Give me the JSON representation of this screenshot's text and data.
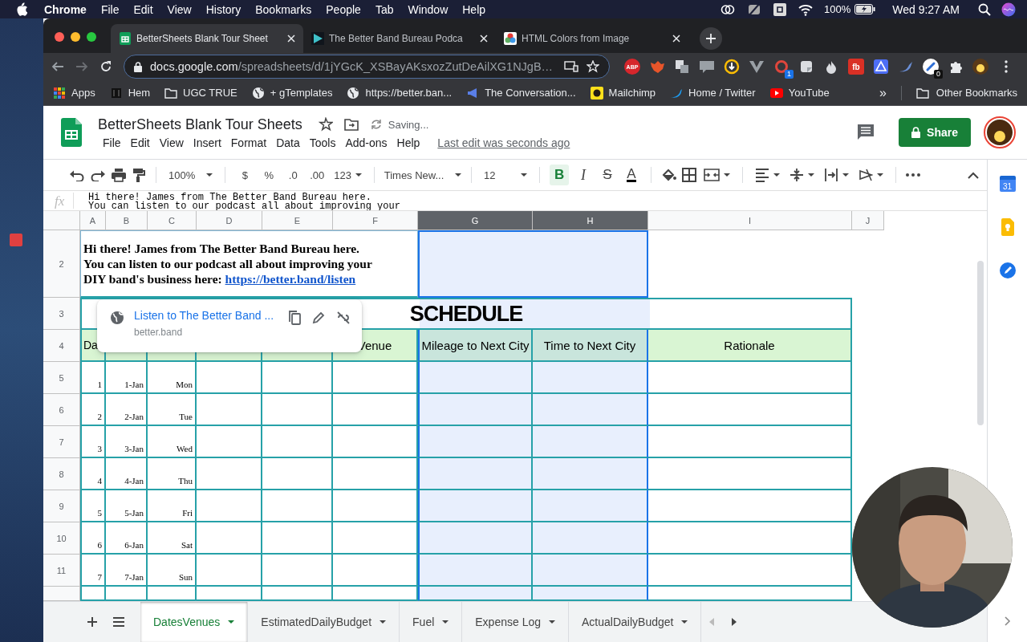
{
  "menu_bar": {
    "app": "Chrome",
    "menus": [
      "File",
      "Edit",
      "View",
      "History",
      "Bookmarks",
      "People",
      "Tab",
      "Window",
      "Help"
    ],
    "battery": "100%",
    "clock": "Wed 9:27 AM"
  },
  "browser": {
    "tabs": [
      {
        "title": "BetterSheets Blank Tour Sheet",
        "kind": "sheets",
        "selected": true
      },
      {
        "title": "The Better Band Bureau Podca",
        "kind": "play",
        "selected": false
      },
      {
        "title": "HTML Colors from Image",
        "kind": "colors",
        "selected": false
      }
    ],
    "url": {
      "host": "docs.google.com",
      "path": "/spreadsheets/d/1jYGcK_XSBayAKsxozZutDeAilXG1NJgB…"
    },
    "extensions": [
      {
        "kind": "abp",
        "label": "ABP"
      },
      {
        "kind": "fox"
      },
      {
        "kind": "translate"
      },
      {
        "kind": "bubble"
      },
      {
        "kind": "download"
      },
      {
        "kind": "vue"
      },
      {
        "kind": "ring",
        "badge": "1"
      },
      {
        "kind": "note"
      },
      {
        "kind": "flame"
      },
      {
        "kind": "tile",
        "label": "fb"
      },
      {
        "kind": "triangle"
      },
      {
        "kind": "bird"
      },
      {
        "kind": "link",
        "badge": "0"
      },
      {
        "kind": "puzzle"
      },
      {
        "kind": "avatar"
      }
    ],
    "bookmarks": [
      {
        "label": "Apps",
        "kind": "apps"
      },
      {
        "label": "Hem",
        "kind": "h"
      },
      {
        "label": "UGC TRUE",
        "kind": "folder"
      },
      {
        "label": "+ gTemplates",
        "kind": "globe"
      },
      {
        "label": "https://better.ban...",
        "kind": "globe"
      },
      {
        "label": "The Conversation...",
        "kind": "flag"
      },
      {
        "label": "Mailchimp",
        "kind": "chimp"
      },
      {
        "label": "Home / Twitter",
        "kind": "bird"
      },
      {
        "label": "YouTube",
        "kind": "youtube"
      }
    ],
    "more": "»",
    "other_bookmarks": "Other Bookmarks"
  },
  "doc": {
    "title": "BetterSheets Blank Tour Sheets",
    "status": "Saving...",
    "menus": [
      "File",
      "Edit",
      "View",
      "Insert",
      "Format",
      "Data",
      "Tools",
      "Add-ons",
      "Help"
    ],
    "last_edit": "Last edit was seconds ago",
    "share": "Share"
  },
  "toolbar": {
    "zoom": "100%",
    "currency": "$",
    "percent": "%",
    "decimal_less": ".0",
    "decimal_more": ".00",
    "number_format": "123",
    "font": "Times New...",
    "font_size": "12",
    "format_buttons": [
      {
        "kind": "bold",
        "label": "B",
        "on": true
      },
      {
        "kind": "italic",
        "label": "I",
        "on": false
      },
      {
        "kind": "strike",
        "label": "S",
        "on": false
      },
      {
        "kind": "color",
        "label": "A",
        "on": false
      }
    ]
  },
  "formula_bar": {
    "label": "fx",
    "lines": [
      "Hi there! James from The Better Band Bureau here.",
      "You can listen to our podcast all about improving your"
    ]
  },
  "grid": {
    "columns": [
      {
        "label": "A",
        "selected": false
      },
      {
        "label": "B",
        "selected": false
      },
      {
        "label": "C",
        "selected": false
      },
      {
        "label": "D",
        "selected": false
      },
      {
        "label": "E",
        "selected": false
      },
      {
        "label": "F",
        "selected": false
      },
      {
        "label": "G",
        "selected": true
      },
      {
        "label": "H",
        "selected": true
      },
      {
        "label": "I",
        "selected": false
      },
      {
        "label": "J",
        "selected": false
      }
    ],
    "intro": {
      "row": "2",
      "lines": [
        "Hi there! James from The Better Band Bureau here.",
        "You can listen to our podcast all about improving your",
        "DIY band's business here:"
      ],
      "link": "https://better.band/listen"
    },
    "title": {
      "row": "3",
      "text": "SCHEDULE"
    },
    "header": {
      "row": "4",
      "cells": [
        {
          "kind": "text",
          "text": "Da"
        },
        {
          "kind": "blank"
        },
        {
          "kind": "blank"
        },
        {
          "kind": "blank"
        },
        {
          "kind": "blank"
        },
        {
          "kind": "text",
          "text": "Venue"
        },
        {
          "kind": "text",
          "text": "Mileage to Next City"
        },
        {
          "kind": "text",
          "text": "Time to Next City"
        },
        {
          "kind": "text",
          "text": "Rationale"
        }
      ]
    },
    "rows": [
      {
        "row": "5",
        "number": "1",
        "date": "1-Jan",
        "day": "Mon"
      },
      {
        "row": "6",
        "number": "2",
        "date": "2-Jan",
        "day": "Tue"
      },
      {
        "row": "7",
        "number": "3",
        "date": "3-Jan",
        "day": "Wed"
      },
      {
        "row": "8",
        "number": "4",
        "date": "4-Jan",
        "day": "Thu"
      },
      {
        "row": "9",
        "number": "5",
        "date": "5-Jan",
        "day": "Fri"
      },
      {
        "row": "10",
        "number": "6",
        "date": "6-Jan",
        "day": "Sat"
      },
      {
        "row": "11",
        "number": "7",
        "date": "7-Jan",
        "day": "Sun"
      }
    ]
  },
  "link_card": {
    "title": "Listen to The Better Band ...",
    "domain": "better.band"
  },
  "sheet_tabs": [
    {
      "label": "DatesVenues",
      "selected": true
    },
    {
      "label": "EstimatedDailyBudget",
      "selected": false
    },
    {
      "label": "Fuel",
      "selected": false
    },
    {
      "label": "Expense Log",
      "selected": false
    },
    {
      "label": "ActualDailyBudget",
      "selected": false
    }
  ],
  "side_panel": {
    "calendar_day": "31"
  }
}
